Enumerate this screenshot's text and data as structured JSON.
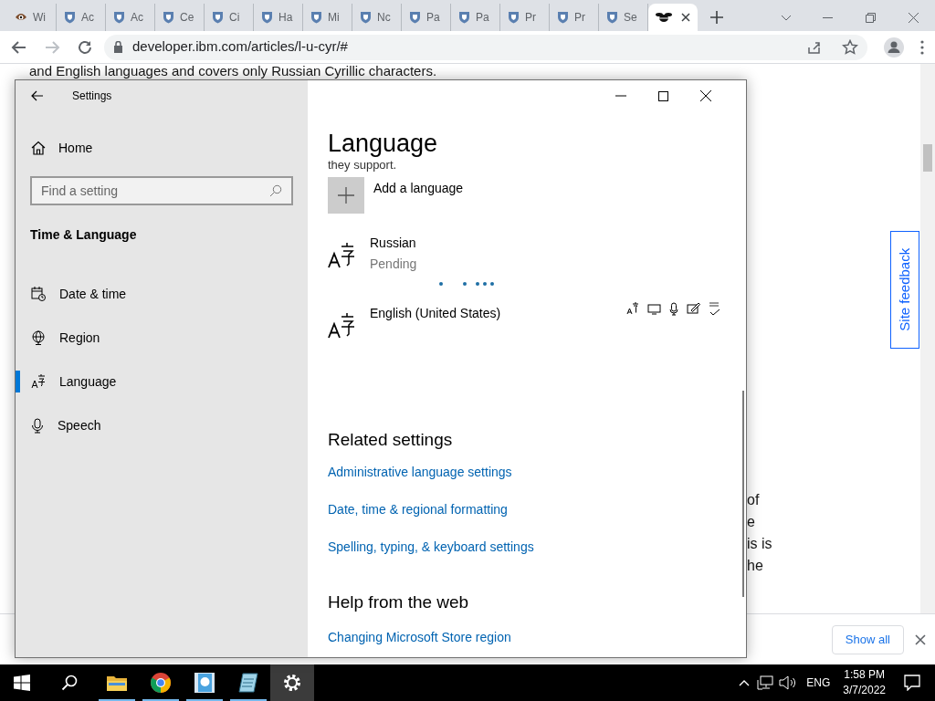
{
  "browser": {
    "tabs": [
      {
        "label": "Wi",
        "kind": "eye",
        "selected": false
      },
      {
        "label": "Ac",
        "kind": "shield",
        "selected": false
      },
      {
        "label": "Ac",
        "kind": "shield",
        "selected": false
      },
      {
        "label": "Ce",
        "kind": "shield",
        "selected": false
      },
      {
        "label": "Ci",
        "kind": "shield",
        "selected": false
      },
      {
        "label": "Ha",
        "kind": "shield",
        "selected": false
      },
      {
        "label": "Mi",
        "kind": "shield",
        "selected": false
      },
      {
        "label": "Nc",
        "kind": "shield",
        "selected": false
      },
      {
        "label": "Pa",
        "kind": "shield",
        "selected": false
      },
      {
        "label": "Pa",
        "kind": "shield",
        "selected": false
      },
      {
        "label": "Pr",
        "kind": "shield",
        "selected": false
      },
      {
        "label": "Pr",
        "kind": "shield",
        "selected": false
      },
      {
        "label": "Se",
        "kind": "shield",
        "selected": false
      },
      {
        "kind": "bee",
        "selected": true
      }
    ],
    "address": "developer.ibm.com/articles/l-u-cyr/#"
  },
  "page": {
    "top_text": "and English languages and covers only Russian Cyrillic characters.",
    "fragments": [
      "of",
      "e",
      "is is",
      "he"
    ],
    "site_feedback": "Site feedback"
  },
  "downloads": {
    "button": "Show all"
  },
  "settings": {
    "title": "Settings",
    "home": "Home",
    "search_placeholder": "Find a setting",
    "section": "Time & Language",
    "nav": [
      {
        "label": "Date & time",
        "kind": "calendar",
        "selected": false
      },
      {
        "label": "Region",
        "kind": "globe",
        "selected": false
      },
      {
        "label": "Language",
        "kind": "language",
        "selected": true
      },
      {
        "label": "Speech",
        "kind": "microphone",
        "selected": false
      }
    ],
    "heading": "Language",
    "intro_fragment": "they support.",
    "add_language": "Add a language",
    "languages": [
      {
        "name": "Russian",
        "kind": "pending",
        "status": "Pending"
      },
      {
        "name": "English (United States)",
        "kind": "installed"
      }
    ],
    "related_title": "Related settings",
    "related_links": [
      "Administrative language settings",
      "Date, time & regional formatting",
      "Spelling, typing, & keyboard settings"
    ],
    "help_title": "Help from the web",
    "help_links": [
      "Changing Microsoft Store region"
    ]
  },
  "taskbar": {
    "apps": [
      {
        "kind": "folder",
        "selected": false
      },
      {
        "kind": "chrome",
        "selected": false
      },
      {
        "kind": "help",
        "selected": false
      },
      {
        "kind": "notepad",
        "selected": false
      },
      {
        "kind": "settings",
        "selected": true
      }
    ],
    "language": "ENG",
    "time": "1:58 PM",
    "date": "3/7/2022"
  }
}
